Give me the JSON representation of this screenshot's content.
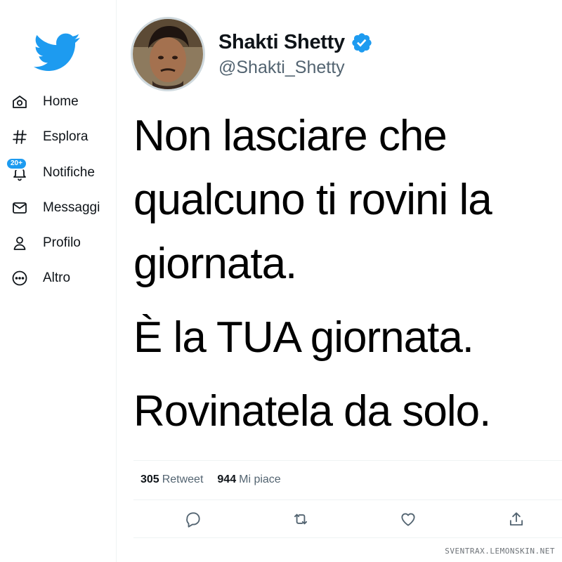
{
  "app": {
    "brand_color": "#1d9bf0",
    "logo_icon": "twitter-bird-icon"
  },
  "sidebar": {
    "items": [
      {
        "label": "Home",
        "icon": "home-icon"
      },
      {
        "label": "Esplora",
        "icon": "hashtag-icon"
      },
      {
        "label": "Notifiche",
        "icon": "bell-icon",
        "badge": "20+"
      },
      {
        "label": "Messaggi",
        "icon": "envelope-icon"
      },
      {
        "label": "Profilo",
        "icon": "person-icon"
      },
      {
        "label": "Altro",
        "icon": "more-circle-icon"
      }
    ]
  },
  "tweet": {
    "author": {
      "name": "Shakti Shetty",
      "handle": "@Shakti_Shetty",
      "verified": true
    },
    "paragraphs": [
      "Non lasciare che qualcuno ti rovini la giornata.",
      "È la TUA giornata.",
      "Rovinatela da solo."
    ],
    "stats": {
      "retweets_count": "305",
      "retweets_label": "Retweet",
      "likes_count": "944",
      "likes_label": "Mi piace"
    },
    "actions": [
      "reply-icon",
      "retweet-icon",
      "like-icon",
      "share-icon"
    ]
  },
  "watermark": "SVENTRAX.LEMONSKIN.NET"
}
